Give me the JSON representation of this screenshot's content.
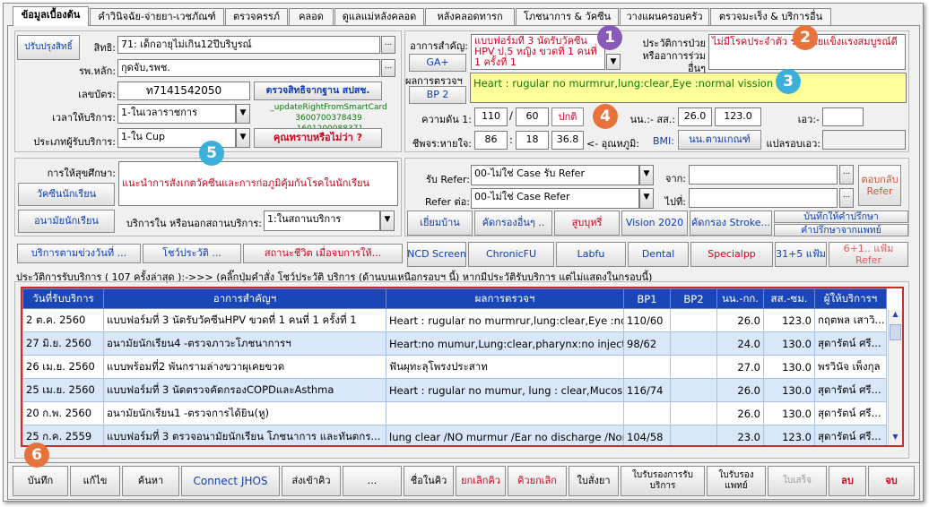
{
  "tabs": [
    "ข้อมูลเบื้องต้น",
    "คำวินิจฉัย-จ่ายยา-เวชภัณฑ์",
    "ตรวจครรภ์",
    "คลอด",
    "ดูแลแม่หลังคลอด",
    "หลังคลอดทารก",
    "โภชนาการ & วัคซีน",
    "วางแผนครอบครัว",
    "ตรวจมะเร็ง & บริการอื่น"
  ],
  "left": {
    "update_btn": "ปรับปรุงสิทธิ์",
    "right_label": "สิทธิ:",
    "right_value": "71: เด็กอายุไม่เกิน12ปีบริบูรณ์",
    "hosp_label": "รพ.หลัก:",
    "hosp_value": "กุดจับ,รพช.",
    "card_label": "เลขบัตร:",
    "card_value": "ท7141542050",
    "check_right_btn": "ตรวจสิทธิจากฐาน สปสช.",
    "time_label": "เวลาให้บริการ:",
    "time_value": "1-ในเวลาราชการ",
    "smartcard_line1": "_updateRightFromSmartCard",
    "smartcard_line2": "3600700378439 ,1601200088371",
    "type_label": "ประเภทผู้รับบริการ:",
    "type_value": "1-ใน Cup",
    "know_btn": "คุณทราบหรือไม่ว่า ?",
    "edu_label": "การให้สุขศึกษา:",
    "edu_text": "แนะนำการสังเกตวัคซีนและการก่อภูมิคุ้มกันโรคในนักเรียน",
    "vaccine_btn": "วัคซีนนักเรียน",
    "school_btn": "อนามัยนักเรียน",
    "service_in_label": "บริการใน หรือนอกสถานบริการ:",
    "service_in_value": "1:ในสถานบริการ"
  },
  "center": {
    "cc_label": "อาการสำคัญ:",
    "cc_value": "แบบฟอร์มที่ 3 นัดรับวัคซีน HPV  ป.5 หญิง ขวดที่ 1 คนที่ 1 ครั้งที่ 1",
    "ga_btn": "GA+",
    "hx_label": "ประวัติการป่วย หรืออาการร่วมอื่นๆ",
    "hx_value": "ไม่มีโรคประจำตัว ร่างกายแข็งแรงสมบูรณ์ดี",
    "pe_label": "ผลการตรวจฯ",
    "bp2_btn": "BP 2",
    "pe_value": "Heart : rugular no murmrur,lung:clear,Eye :normal vission",
    "bp_label": "ความดัน 1:",
    "bp_sys": "110",
    "bp_dia": "60",
    "bp_status": "ปกติ",
    "wt_label": "นน.:- สส.:",
    "weight": "26.0",
    "height": "123.0",
    "waist_label": "เอว:-",
    "waist": "",
    "pulse_label": "ชีพจร:หายใจ:",
    "pulse": "86",
    "resp": "18",
    "temp": "36.8",
    "temp_label": "<- อุณหภูมิ:",
    "bmi_label": "BMI:",
    "bmi_btn": "นน.ตามเกณฑ์",
    "bmi_translate": "แปลรอบเอว:"
  },
  "refer": {
    "in_label": "รับ Refer:",
    "in_value": "00-ไม่ใช่ Case รับ Refer",
    "out_label": "Refer ต่อ:",
    "out_value": "00-ไม่ใช่ Case Refer",
    "from_label": "จาก:",
    "to_label": "ไปที่:",
    "reply_btn": "ตอบกลับ Refer"
  },
  "row_btns": [
    "เยี่ยมบ้าน",
    "คัดกรองอื่นๆ ..",
    "สูบบุหรี่",
    "Vision 2020",
    "คัดกรอง Stroke...",
    "บันทึกให้คำปรึกษา",
    "คำปรึกษาจากแพทย์"
  ],
  "row_btns2": [
    "บริการตามข่วงวันที่ ...",
    "โชว์ประวัติ ...",
    "สถานะชีวิต เมื่อจบการให้...",
    "NCD Screen",
    "ChronicFU",
    "Labfu",
    "Dental",
    "Specialpp",
    "31+5 แฟ้ม",
    "6+1.. แฟ้ม Refer"
  ],
  "history": {
    "label": "ประวัติการรับบริการ ( 107 ครั้งล่าสุด ):->>> (คลิ๊กปุ่มคำสั่ง โชว์ประวัติ บริการ (ด้านบนเหนือกรอบฯ นี้) หากมีประวัติรับบริการ แต่ไม่แสดงในกรอบนี้)",
    "columns": [
      "วันที่รับบริการ",
      "อาการสำคัญฯ",
      "ผลการตรวจฯ",
      "BP1",
      "BP2",
      "นน.-กก.",
      "สส.-ซม.",
      "ผู้ให้บริการฯ"
    ],
    "rows": [
      [
        "2 ต.ค. 2560",
        "แบบฟอร์มที่ 3 นัดรับวัคซีนHPV ขวดที่ 1 คนที่ 1 ครั้งที่ 1",
        "Heart : rugular no murmrur,lung:clear,Eye :nor...",
        "110/60",
        "",
        "26.0",
        "123.0",
        "กฤตพล  เสาวิ..."
      ],
      [
        "27 มิ.ย. 2560",
        "อนามัยนักเรียน4 -ตรวจภาวะโภชนาการฯ",
        "Heart:no mumur,Lung:clear,pharynx:no injected",
        "98/62",
        "",
        "24.0",
        "130.0",
        "สุดารัตน์  ศรี..."
      ],
      [
        "26 เม.ย. 2560",
        "แบบพร้อมที่2 พันกรามล่างขวาผุเคยขวด",
        "ฟันผุทะลุโพรงประสาท",
        "",
        "",
        "27.0",
        "130.0",
        "พรวินัจ  เพ็งกุล"
      ],
      [
        "25 เม.ย. 2560",
        "แบบฟอร์มที่ 3 นัดตรวจคัดกรองCOPDและAsthma",
        "Heart : rugular no mumur, lung : clear,Mucosa ...",
        "116/74",
        "",
        "26.0",
        "130.0",
        "สุดารัตน์  ศรี..."
      ],
      [
        "20 ก.พ. 2560",
        "อนามัยนักเรียน1 -ตรวจการได้ยิน(หู)",
        "",
        "",
        "",
        "26.0",
        "130.0",
        "สุดารัตน์  ศรี..."
      ],
      [
        "25 ก.ค. 2559",
        "แบบฟอร์มที่ 3 ตรวจอนามัยนักเรียน โภชนาการ และทันตกร...",
        "lung clear /NO murmur /Ear no discharge /Nor...",
        "104/58",
        "",
        "23.0",
        "123.0",
        "สุดารัตน์  ศรี..."
      ]
    ]
  },
  "bottom": [
    "บันทึก",
    "แก้ไข",
    "ค้นหา",
    "Connect JHOS",
    "ส่งเข้าคิว",
    "...",
    "ชื่อในคิว",
    "ยกเลิกคิว",
    "คิวยกเลิก",
    "ใบสั่งยา",
    "ใบรับรองการรับบริการ",
    "ใบรับรองแพทย์",
    "ใบเสร็จ",
    "ลบ",
    "จบ"
  ],
  "markers": [
    "1",
    "2",
    "3",
    "4",
    "5",
    "6"
  ],
  "colors": {
    "marker1": "#8a5ab8",
    "marker2": "#e8733a",
    "marker3": "#3cb0d8",
    "marker4": "#e8733a",
    "marker5": "#3cb0d8",
    "marker6": "#e8733a",
    "grid_header": "#1a47b8"
  }
}
